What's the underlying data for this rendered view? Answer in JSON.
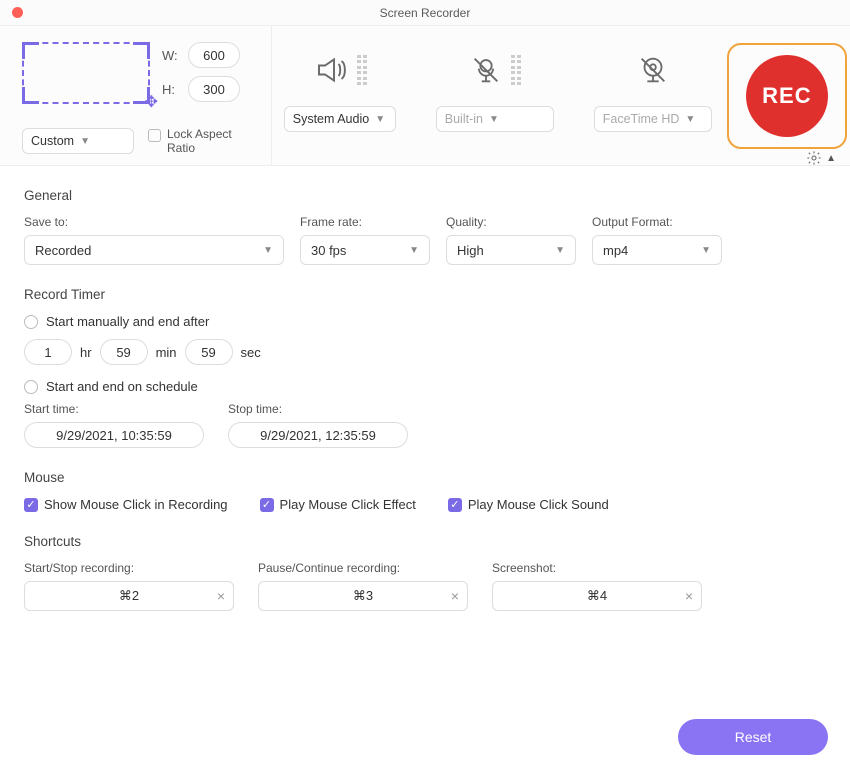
{
  "title": "Screen Recorder",
  "region": {
    "width": "600",
    "height": "300",
    "wLabel": "W:",
    "hLabel": "H:",
    "preset": "Custom",
    "lockAspect": "Lock Aspect Ratio"
  },
  "audio": {
    "source": "System Audio",
    "camera": "Built-in",
    "webcam": "FaceTime HD"
  },
  "recLabel": "REC",
  "general": {
    "title": "General",
    "saveToLabel": "Save to:",
    "saveTo": "Recorded",
    "frameRateLabel": "Frame rate:",
    "frameRate": "30 fps",
    "qualityLabel": "Quality:",
    "quality": "High",
    "outputFormatLabel": "Output Format:",
    "outputFormat": "mp4"
  },
  "timer": {
    "title": "Record Timer",
    "manualLabel": "Start manually and end after",
    "hr": "1",
    "hrUnit": "hr",
    "min": "59",
    "minUnit": "min",
    "sec": "59",
    "secUnit": "sec",
    "scheduleLabel": "Start and end on schedule",
    "startLabel": "Start time:",
    "start": "9/29/2021, 10:35:59",
    "stopLabel": "Stop time:",
    "stop": "9/29/2021, 12:35:59"
  },
  "mouse": {
    "title": "Mouse",
    "showClick": "Show Mouse Click in Recording",
    "playEffect": "Play Mouse Click Effect",
    "playSound": "Play Mouse Click Sound"
  },
  "shortcuts": {
    "title": "Shortcuts",
    "startStopLabel": "Start/Stop recording:",
    "startStop": "⌘2",
    "pauseLabel": "Pause/Continue recording:",
    "pause": "⌘3",
    "screenshotLabel": "Screenshot:",
    "screenshot": "⌘4"
  },
  "reset": "Reset"
}
